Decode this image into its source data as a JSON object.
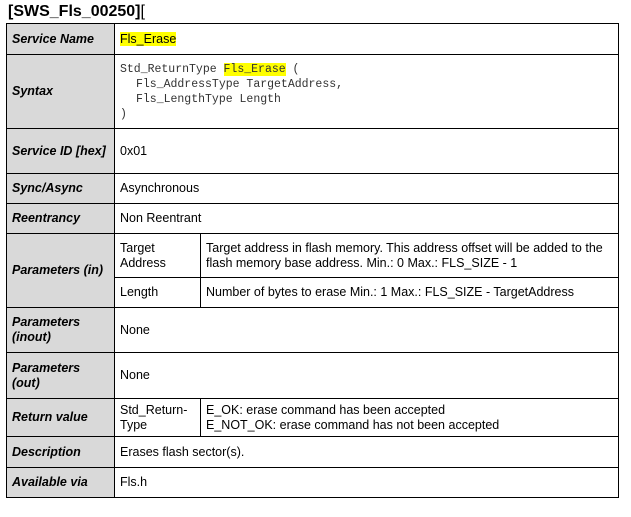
{
  "requirement": {
    "id": "[SWS_Fls_00250]",
    "bracket": "["
  },
  "rows": {
    "service_name": {
      "label": "Service Name",
      "value": "Fls_Erase"
    },
    "syntax": {
      "label": "Syntax",
      "line1_prefix": "Std_ReturnType ",
      "line1_name": "Fls_Erase",
      "line1_suffix": " (",
      "line2": "Fls_AddressType TargetAddress,",
      "line3": "Fls_LengthType Length",
      "line4": ")"
    },
    "service_id": {
      "label": "Service ID [hex]",
      "value": "0x01"
    },
    "sync_async": {
      "label": "Sync/Async",
      "value": "Asynchronous"
    },
    "reentrancy": {
      "label": "Reentrancy",
      "value": "Non Reentrant"
    },
    "parameters_in": {
      "label": "Parameters (in)",
      "params": [
        {
          "name": "Target Address",
          "desc": "Target address in flash memory. This address offset will be added to the flash memory base address. Min.: 0 Max.: FLS_SIZE - 1"
        },
        {
          "name": "Length",
          "desc": "Number of bytes to erase Min.: 1 Max.: FLS_SIZE - TargetAddress"
        }
      ]
    },
    "parameters_inout": {
      "label": "Parameters (inout)",
      "value": "None"
    },
    "parameters_out": {
      "label": "Parameters (out)",
      "value": "None"
    },
    "return_value": {
      "label": "Return value",
      "type": "Std_Return-Type",
      "line1": "E_OK: erase command has been accepted",
      "line2": "E_NOT_OK: erase command has not been accepted"
    },
    "description": {
      "label": "Description",
      "value": "Erases flash sector(s)."
    },
    "available_via": {
      "label": "Available via",
      "value": "Fls.h"
    }
  },
  "colors": {
    "label_bg": "#d9d9d9",
    "highlight": "#ffff00",
    "border": "#000000"
  }
}
